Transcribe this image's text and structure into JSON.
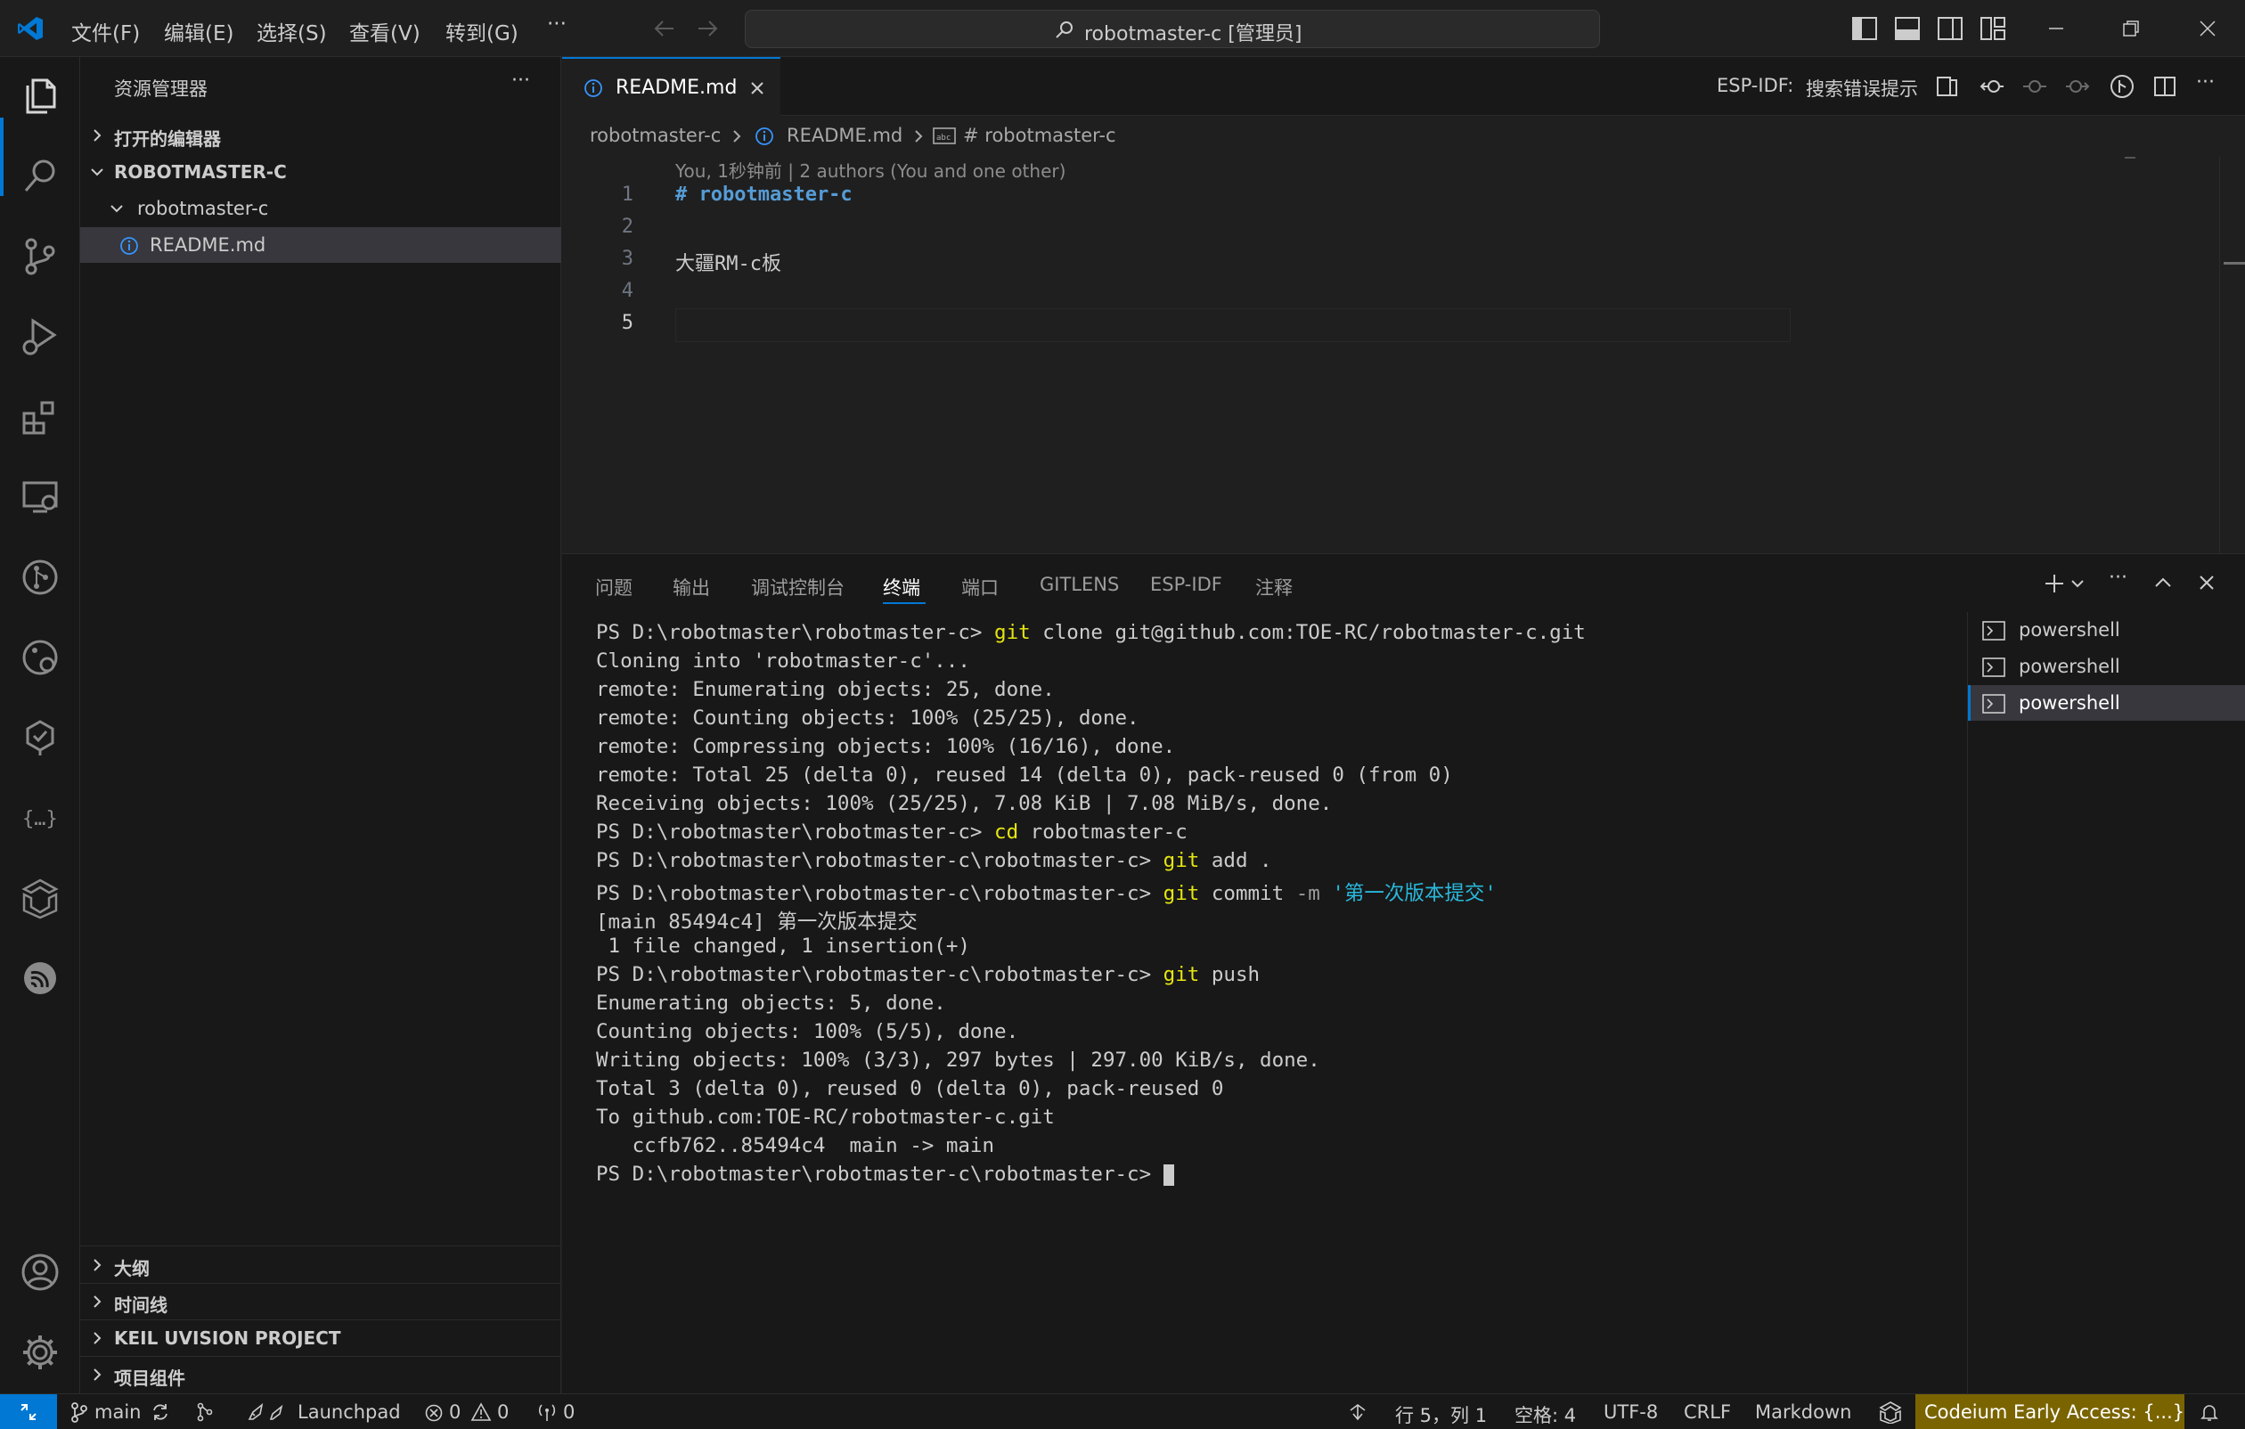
{
  "titlebar": {
    "menus": [
      "文件(F)",
      "编辑(E)",
      "选择(S)",
      "查看(V)",
      "转到(G)",
      "···"
    ],
    "command_center": "robotmaster-c [管理员]"
  },
  "sidebar": {
    "title": "资源管理器",
    "more": "···",
    "open_editors": "打开的编辑器",
    "root": "ROBOTMASTER-C",
    "folder": "robotmaster-c",
    "file": "README.md",
    "bottom_sections": [
      "大纲",
      "时间线",
      "KEIL UVISION PROJECT",
      "项目组件"
    ]
  },
  "editor": {
    "tab_label": "README.md",
    "esp_idf_label": "ESP-IDF:",
    "esp_idf_action": "搜索错误提示",
    "breadcrumb": [
      "robotmaster-c",
      "README.md",
      "# robotmaster-c"
    ],
    "blame": "You, 1秒钟前 | 2 authors (You and one other)",
    "lines": [
      {
        "num": "1",
        "text": "# robotmaster-c"
      },
      {
        "num": "2",
        "text": ""
      },
      {
        "num": "3",
        "text": "大疆RM-c板"
      },
      {
        "num": "4",
        "text": ""
      },
      {
        "num": "5",
        "text": ""
      }
    ]
  },
  "panel": {
    "tabs": [
      "问题",
      "输出",
      "调试控制台",
      "终端",
      "端口",
      "GITLENS",
      "ESP-IDF",
      "注释"
    ],
    "active_tab": "终端",
    "terminals": [
      "powershell",
      "powershell",
      "powershell"
    ],
    "terminal_lines": [
      {
        "prompt": "PS D:\\robotmaster\\robotmaster-c> ",
        "cmd": "git",
        "rest": " clone git@github.com:TOE-RC/robotmaster-c.git"
      },
      {
        "text": "Cloning into 'robotmaster-c'..."
      },
      {
        "text": "remote: Enumerating objects: 25, done."
      },
      {
        "text": "remote: Counting objects: 100% (25/25), done."
      },
      {
        "text": "remote: Compressing objects: 100% (16/16), done."
      },
      {
        "text": "remote: Total 25 (delta 0), reused 14 (delta 0), pack-reused 0 (from 0)"
      },
      {
        "text": "Receiving objects: 100% (25/25), 7.08 KiB | 7.08 MiB/s, done."
      },
      {
        "prompt": "PS D:\\robotmaster\\robotmaster-c> ",
        "cmd": "cd",
        "rest": " robotmaster-c"
      },
      {
        "prompt": "PS D:\\robotmaster\\robotmaster-c\\robotmaster-c> ",
        "cmd": "git",
        "rest": " add ."
      },
      {
        "prompt": "PS D:\\robotmaster\\robotmaster-c\\robotmaster-c> ",
        "cmd": "git",
        "rest": " commit ",
        "flag": "-m",
        "str": " '第一次版本提交'"
      },
      {
        "text": "[main 85494c4] 第一次版本提交"
      },
      {
        "text": " 1 file changed, 1 insertion(+)"
      },
      {
        "prompt": "PS D:\\robotmaster\\robotmaster-c\\robotmaster-c> ",
        "cmd": "git",
        "rest": " push"
      },
      {
        "text": "Enumerating objects: 5, done."
      },
      {
        "text": "Counting objects: 100% (5/5), done."
      },
      {
        "text": "Writing objects: 100% (3/3), 297 bytes | 297.00 KiB/s, done."
      },
      {
        "text": "Total 3 (delta 0), reused 0 (delta 0), pack-reused 0"
      },
      {
        "text": "To github.com:TOE-RC/robotmaster-c.git"
      },
      {
        "text": "   ccfb762..85494c4  main -> main"
      },
      {
        "prompt": "PS D:\\robotmaster\\robotmaster-c\\robotmaster-c> ",
        "cursor": true
      }
    ]
  },
  "statusbar": {
    "branch": "main",
    "launchpad": "Launchpad",
    "errors": "0",
    "warnings": "0",
    "ports": "0",
    "position": "行 5，列 1",
    "spaces": "空格: 4",
    "encoding": "UTF-8",
    "eol": "CRLF",
    "language": "Markdown",
    "codeium": "Codeium Early Access: {...}"
  },
  "colors": {
    "accent": "#0078d4",
    "codeium_bg": "#7a6400",
    "heading": "#569cd6",
    "terminal_cmd": "#e5e510",
    "terminal_string": "#29b8db"
  }
}
